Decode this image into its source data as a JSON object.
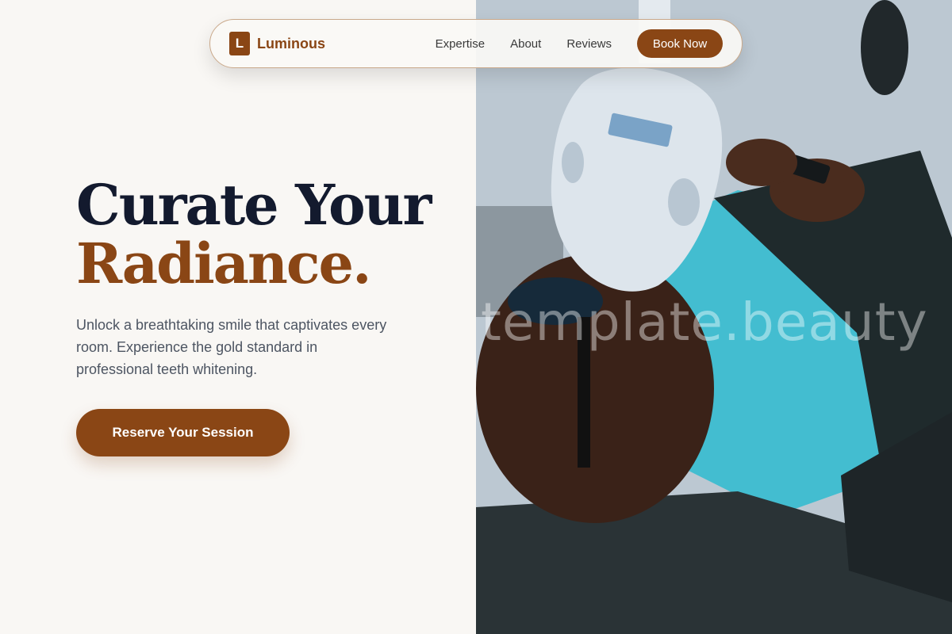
{
  "nav": {
    "logo_letter": "L",
    "brand": "Luminous",
    "links": [
      "Expertise",
      "About",
      "Reviews"
    ],
    "cta": "Book Now"
  },
  "hero": {
    "headline_line1": "Curate Your",
    "headline_line2": "Radiance.",
    "subtext": "Unlock a breathtaking smile that captivates every room. Experience the gold standard in professional teeth whitening.",
    "cta": "Reserve Your Session"
  },
  "image": {
    "watermark": "template.beauty",
    "icon": "teeth-whitening-photo"
  },
  "colors": {
    "accent": "#8a4615",
    "heading": "#131a2e",
    "background": "#f9f7f4"
  }
}
